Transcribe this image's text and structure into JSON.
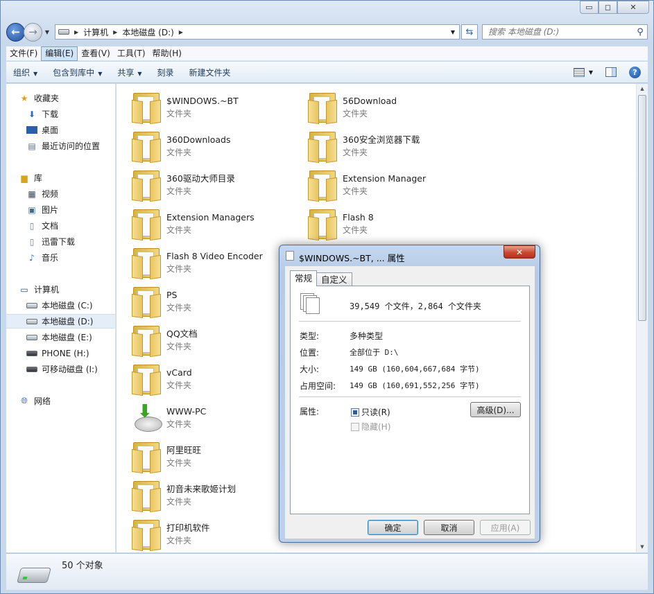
{
  "window": {
    "caption": {
      "minimize": "▭",
      "maximize": "◻",
      "close": "✕"
    }
  },
  "address": {
    "segments": [
      "计算机",
      "本地磁盘 (D:)"
    ],
    "search_placeholder": "搜索 本地磁盘 (D:)"
  },
  "menu": [
    "文件(F)",
    "编辑(E)",
    "查看(V)",
    "工具(T)",
    "帮助(H)"
  ],
  "commands": {
    "organize": "组织",
    "include_library": "包含到库中",
    "share": "共享",
    "burn": "刻录",
    "new_folder": "新建文件夹"
  },
  "navpane": {
    "favorites": "收藏夹",
    "downloads": "下载",
    "desktop": "桌面",
    "recent": "最近访问的位置",
    "libraries": "库",
    "videos": "视频",
    "pictures": "图片",
    "documents": "文档",
    "xunlei": "迅雷下载",
    "music": "音乐",
    "computer": "计算机",
    "drive_c": "本地磁盘 (C:)",
    "drive_d": "本地磁盘 (D:)",
    "drive_e": "本地磁盘 (E:)",
    "drive_h": "PHONE (H:)",
    "drive_i": "可移动磁盘 (I:)",
    "network": "网络"
  },
  "files": {
    "type_label": "文件夹",
    "col1": [
      "$WINDOWS.~BT",
      "360Downloads",
      "360驱动大师目录",
      "Extension Managers",
      "Flash 8 Video Encoder",
      "PS",
      "QQ文档",
      "vCard",
      "WWW-PC",
      "阿里旺旺",
      "初音未来歌姬计划",
      "打印机软件"
    ],
    "col2": [
      "56Download",
      "360安全浏览器下载",
      "Extension Manager",
      "Flash 8"
    ]
  },
  "details": {
    "count": "50 个对象"
  },
  "dialog": {
    "title": "$WINDOWS.~BT, ... 属性",
    "tabs": [
      "常规",
      "自定义"
    ],
    "summary": "39,549 个文件，2,864 个文件夹",
    "type_label": "类型:",
    "type_value": "多种类型",
    "location_label": "位置:",
    "location_value": "全部位于 D:\\",
    "size_label": "大小:",
    "size_value": "149 GB (160,604,667,684 字节)",
    "disk_label": "占用空间:",
    "disk_value": "149 GB (160,691,552,256 字节)",
    "attr_label": "属性:",
    "readonly": "只读(R)",
    "hidden": "隐藏(H)",
    "advanced": "高级(D)...",
    "ok": "确定",
    "cancel": "取消",
    "apply": "应用(A)"
  }
}
